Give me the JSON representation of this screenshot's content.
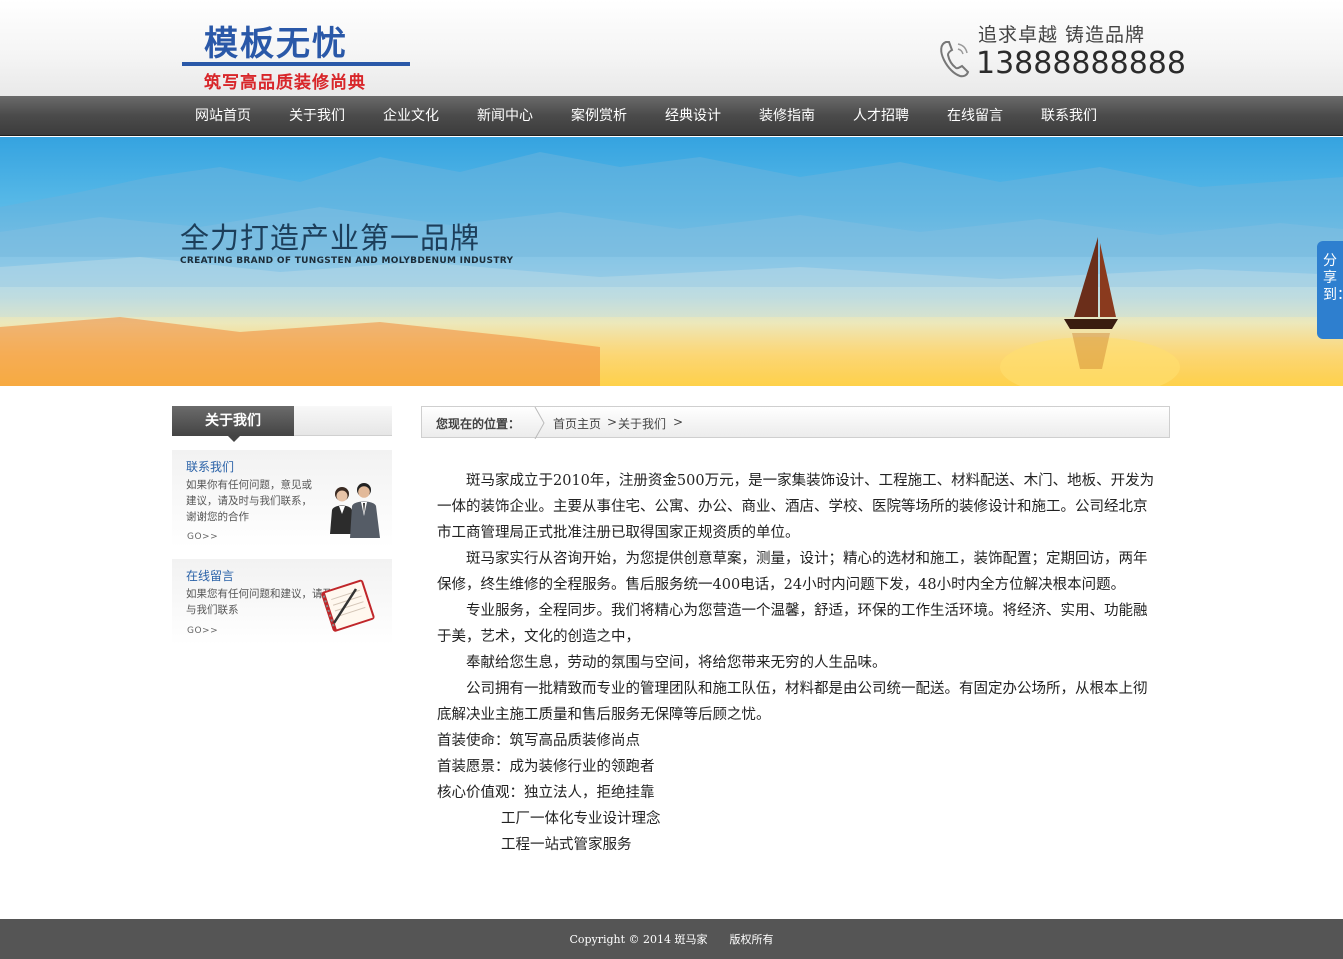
{
  "header": {
    "logo_title": "模板无忧",
    "logo_subtitle": "筑写高品质装修尚典",
    "slogan": "追求卓越 铸造品牌",
    "phone": "13888888888"
  },
  "nav": {
    "items": [
      "网站首页",
      "关于我们",
      "企业文化",
      "新闻中心",
      "案例赏析",
      "经典设计",
      "装修指南",
      "人才招聘",
      "在线留言",
      "联系我们"
    ]
  },
  "banner": {
    "title": "全力打造产业第一品牌",
    "subtitle": "CREATING BRAND OF TUNGSTEN AND MOLYBDENUM INDUSTRY"
  },
  "share": {
    "label": "分享到："
  },
  "sidebar": {
    "heading": "关于我们",
    "contact": {
      "title": "联系我们",
      "text": "如果你有任何问题，意见或建议，请及时与我们联系，谢谢您的合作",
      "go": "GO>>"
    },
    "message": {
      "title": "在线留言",
      "text": "如果您有任何问题和建议，请及时与我们联系",
      "go": "GO>>"
    }
  },
  "breadcrumb": {
    "label": "您现在的位置：",
    "items": [
      "首页主页",
      "关于我们"
    ],
    "arrow": ">"
  },
  "content": {
    "paragraphs": [
      "斑马家成立于2010年，注册资金500万元，是一家集装饰设计、工程施工、材料配送、木门、地板、开发为一体的装饰企业。主要从事住宅、公寓、办公、商业、酒店、学校、医院等场所的装修设计和施工。公司经北京市工商管理局正式批准注册已取得国家正规资质的单位。",
      "斑马家实行从咨询开始，为您提供创意草案，测量，设计；精心的选材和施工，装饰配置；定期回访，两年保修，终生维修的全程服务。售后服务统一400电话，24小时内问题下发，48小时内全方位解决根本问题。",
      "专业服务，全程同步。我们将精心为您营造一个温馨，舒适，环保的工作生活环境。将经济、实用、功能融于美，艺术，文化的创造之中，",
      "奉献给您生息，劳动的氛围与空间，将给您带来无穷的人生品味。",
      "公司拥有一批精致而专业的管理团队和施工队伍，材料都是由公司统一配送。有固定办公场所，从根本上彻底解决业主施工质量和售后服务无保障等后顾之忧。"
    ],
    "mission": "首装使命：筑写高品质装修尚点",
    "vision": "首装愿景：成为装修行业的领跑者",
    "values": "核心价值观：独立法人，拒绝挂靠",
    "values_extra_1": "工厂一体化专业设计理念",
    "values_extra_2": "工程一站式管家服务"
  },
  "footer": {
    "copyright": "Copyright © 2014 斑马家　　版权所有"
  },
  "colors": {
    "brand_blue": "#2a58a8",
    "brand_red": "#d8262a",
    "nav_bg": "#4b4b4b",
    "footer_bg": "#555555",
    "share_blue": "#2e7fcf"
  }
}
